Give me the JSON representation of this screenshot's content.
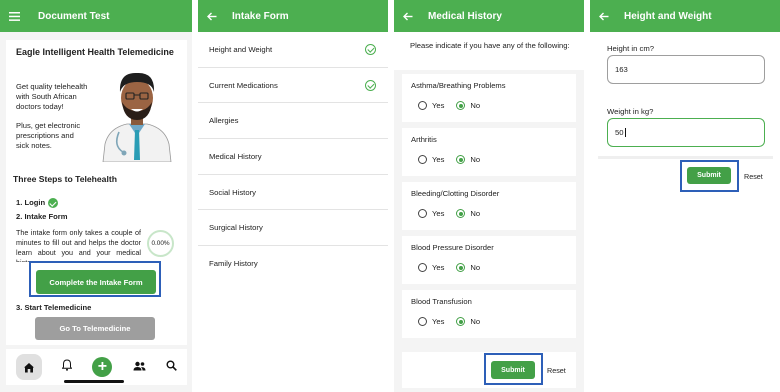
{
  "colors": {
    "accent": "#4caf50",
    "button": "#43a047",
    "highlight": "#2d5fb8",
    "disabled": "#9e9e9e"
  },
  "panel1": {
    "title": "Document Test",
    "heading": "Eagle Intelligent Health Telemedicine",
    "promo1": "Get quality telehealth with South African doctors today!",
    "promo2": "Plus, get electronic prescriptions and sick notes.",
    "steps_heading": "Three Steps to Telehealth",
    "step1": "1. Login",
    "step2": "2. Intake Form",
    "step2_text": "The intake form only takes a couple of minutes to fill out and helps the doctor learn about you and your medical history.",
    "progress": "0.00%",
    "intake_button": "Complete the Intake Form",
    "step3": "3. Start Telemedicine",
    "telemed_button": "Go To Telemedicine",
    "nav_icons": [
      "home-icon",
      "bell-icon",
      "plus-icon",
      "people-icon",
      "search-icon"
    ]
  },
  "panel2": {
    "title": "Intake Form",
    "items": [
      {
        "label": "Height and Weight",
        "done": true
      },
      {
        "label": "Current Medications",
        "done": true
      },
      {
        "label": "Allergies",
        "done": false
      },
      {
        "label": "Medical History",
        "done": false
      },
      {
        "label": "Social History",
        "done": false
      },
      {
        "label": "Surgical History",
        "done": false
      },
      {
        "label": "Family History",
        "done": false
      }
    ]
  },
  "panel3": {
    "title": "Medical History",
    "intro": "Please indicate if you have any of the following:",
    "questions": [
      {
        "label": "Asthma/Breathing Problems",
        "answer": "No"
      },
      {
        "label": "Arthritis",
        "answer": "No"
      },
      {
        "label": "Bleeding/Clotting Disorder",
        "answer": "No"
      },
      {
        "label": "Blood Pressure Disorder",
        "answer": "No"
      },
      {
        "label": "Blood Transfusion",
        "answer": "No"
      }
    ],
    "yes": "Yes",
    "no": "No",
    "submit": "Submit",
    "reset": "Reset"
  },
  "panel4": {
    "title": "Height and Weight",
    "height_label": "Height in cm?",
    "height_value": "163",
    "weight_label": "Weight in kg?",
    "weight_value": "50",
    "submit": "Submit",
    "reset": "Reset"
  }
}
